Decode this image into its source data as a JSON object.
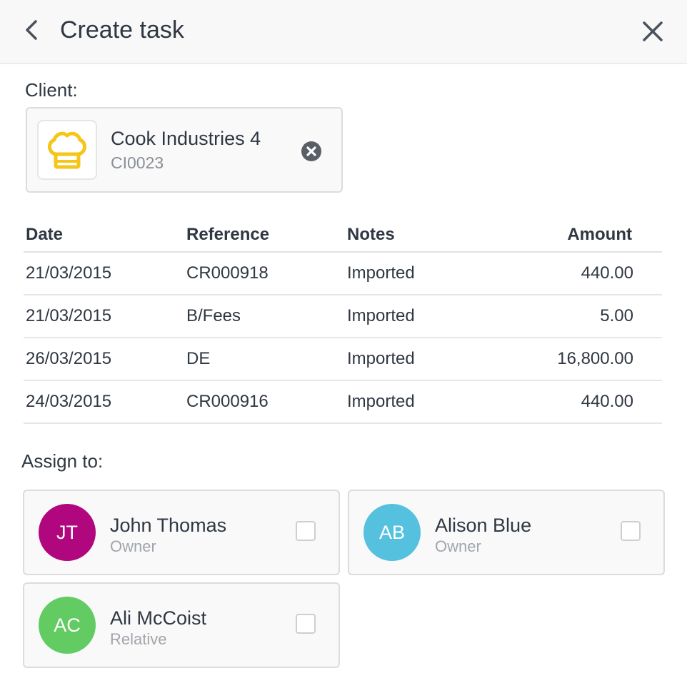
{
  "header": {
    "title": "Create task"
  },
  "client": {
    "label": "Client:",
    "name": "Cook Industries 4",
    "code": "CI0023",
    "logo_icon": "chef-hat-icon",
    "logo_color": "#f5c518"
  },
  "transactions": {
    "columns": {
      "date": "Date",
      "reference": "Reference",
      "notes": "Notes",
      "amount": "Amount"
    },
    "rows": [
      {
        "date": "21/03/2015",
        "reference": "CR000918",
        "notes": "Imported",
        "amount": "440.00"
      },
      {
        "date": "21/03/2015",
        "reference": "B/Fees",
        "notes": "Imported",
        "amount": "5.00"
      },
      {
        "date": "26/03/2015",
        "reference": "DE",
        "notes": "Imported",
        "amount": "16,800.00"
      },
      {
        "date": "24/03/2015",
        "reference": "CR000916",
        "notes": "Imported",
        "amount": "440.00"
      }
    ]
  },
  "assign": {
    "label": "Assign to:",
    "people": [
      {
        "initials": "JT",
        "name": "John Thomas",
        "role": "Owner",
        "color": "#b1077e"
      },
      {
        "initials": "AB",
        "name": "Alison Blue",
        "role": "Owner",
        "color": "#55c1de"
      },
      {
        "initials": "AC",
        "name": "Ali McCoist",
        "role": "Relative",
        "color": "#62cb62"
      }
    ]
  }
}
